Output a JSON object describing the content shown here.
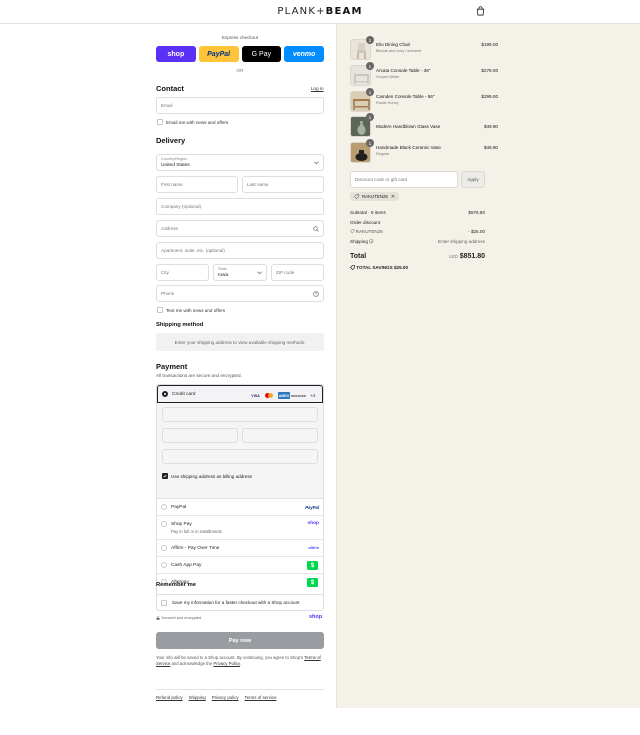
{
  "header": {
    "brand_light": "PLANK+",
    "brand_bold": "BEAM"
  },
  "express": {
    "label": "Express checkout",
    "buttons": [
      "shop",
      "PayPal",
      "G Pay",
      "venmo"
    ],
    "or": "OR"
  },
  "contact": {
    "title": "Contact",
    "login": "Log in",
    "email_placeholder": "Email",
    "news_label": "Email me with news and offers"
  },
  "delivery": {
    "title": "Delivery",
    "country_label": "Country/Region",
    "country_value": "United States",
    "first_name": "First name",
    "last_name": "Last name",
    "company": "Company (optional)",
    "address": "Address",
    "apartment": "Apartment, suite, etc. (optional)",
    "city": "City",
    "state_label": "State",
    "state_value": "Iowa",
    "zip": "ZIP code",
    "phone": "Phone",
    "text_label": "Text me with news and offers"
  },
  "shipping_method": {
    "title": "Shipping method",
    "message": "Enter your shipping address to view available shipping methods."
  },
  "payment": {
    "title": "Payment",
    "subtitle": "All transactions are secure and encrypted.",
    "credit_card": "Credit card",
    "card_logos": [
      "VISA",
      "MC",
      "AMEX",
      "DISCOVER"
    ],
    "more_cards": "+4",
    "billing_same": "Use shipping address as billing address",
    "options": [
      {
        "label": "PayPal",
        "sub": "",
        "logo": "PayPal"
      },
      {
        "label": "Shop Pay",
        "sub": "Pay in full or in installments",
        "logo": "shop"
      },
      {
        "label": "Affirm - Pay Over Time",
        "sub": "",
        "logo": "affirm"
      },
      {
        "label": "Cash App Pay",
        "sub": "",
        "logo": "$"
      },
      {
        "label": "Afterpay",
        "sub": "",
        "logo": "$"
      }
    ]
  },
  "remember": {
    "title": "Remember me",
    "save_label": "Save my information for a faster checkout with a Shop account",
    "secure": "Secured and encrypted",
    "shop_logo": "shop"
  },
  "pay_now": "Pay now",
  "legal": {
    "line1": "Your info will be saved to a Shop account. By continuing, you agree to Shop's",
    "tos": "Terms of Service",
    "mid": "and acknowledge the",
    "privacy": "Privacy Policy",
    "end": "."
  },
  "footer": [
    "Refund policy",
    "Shipping",
    "Privacy policy",
    "Terms of service"
  ],
  "order": {
    "items": [
      {
        "qty": "1",
        "name": "Elio Dining Chair",
        "variant": "Blonde and ivory / textured",
        "price": "$199.00"
      },
      {
        "qty": "1",
        "name": "Arcata Console Table - 36\"",
        "variant": "Greyed White",
        "price": "$279.00"
      },
      {
        "qty": "1",
        "name": "Camden Console Table - 56\"",
        "variant": "Rustic Honey",
        "price": "$299.00"
      },
      {
        "qty": "1",
        "name": "Modern Handblown Glass Vase",
        "variant": "",
        "price": "$49.90"
      },
      {
        "qty": "1",
        "name": "Handmade Black Ceramic Vase",
        "variant": "Regular",
        "price": "$49.90"
      }
    ],
    "discount_placeholder": "Discount code or gift card",
    "apply": "Apply",
    "code_tag": "RAKUTEN25",
    "subtotal_label": "Subtotal · 5 items",
    "subtotal": "$876.80",
    "order_discount_label": "Order discount",
    "discount_code": "RAKUTEN25",
    "discount_amount": "- $25.00",
    "shipping_label": "Shipping",
    "shipping_value": "Enter shipping address",
    "total_label": "Total",
    "currency": "USD",
    "total": "$851.80",
    "savings_label": "TOTAL SAVINGS",
    "savings": "$25.00"
  }
}
